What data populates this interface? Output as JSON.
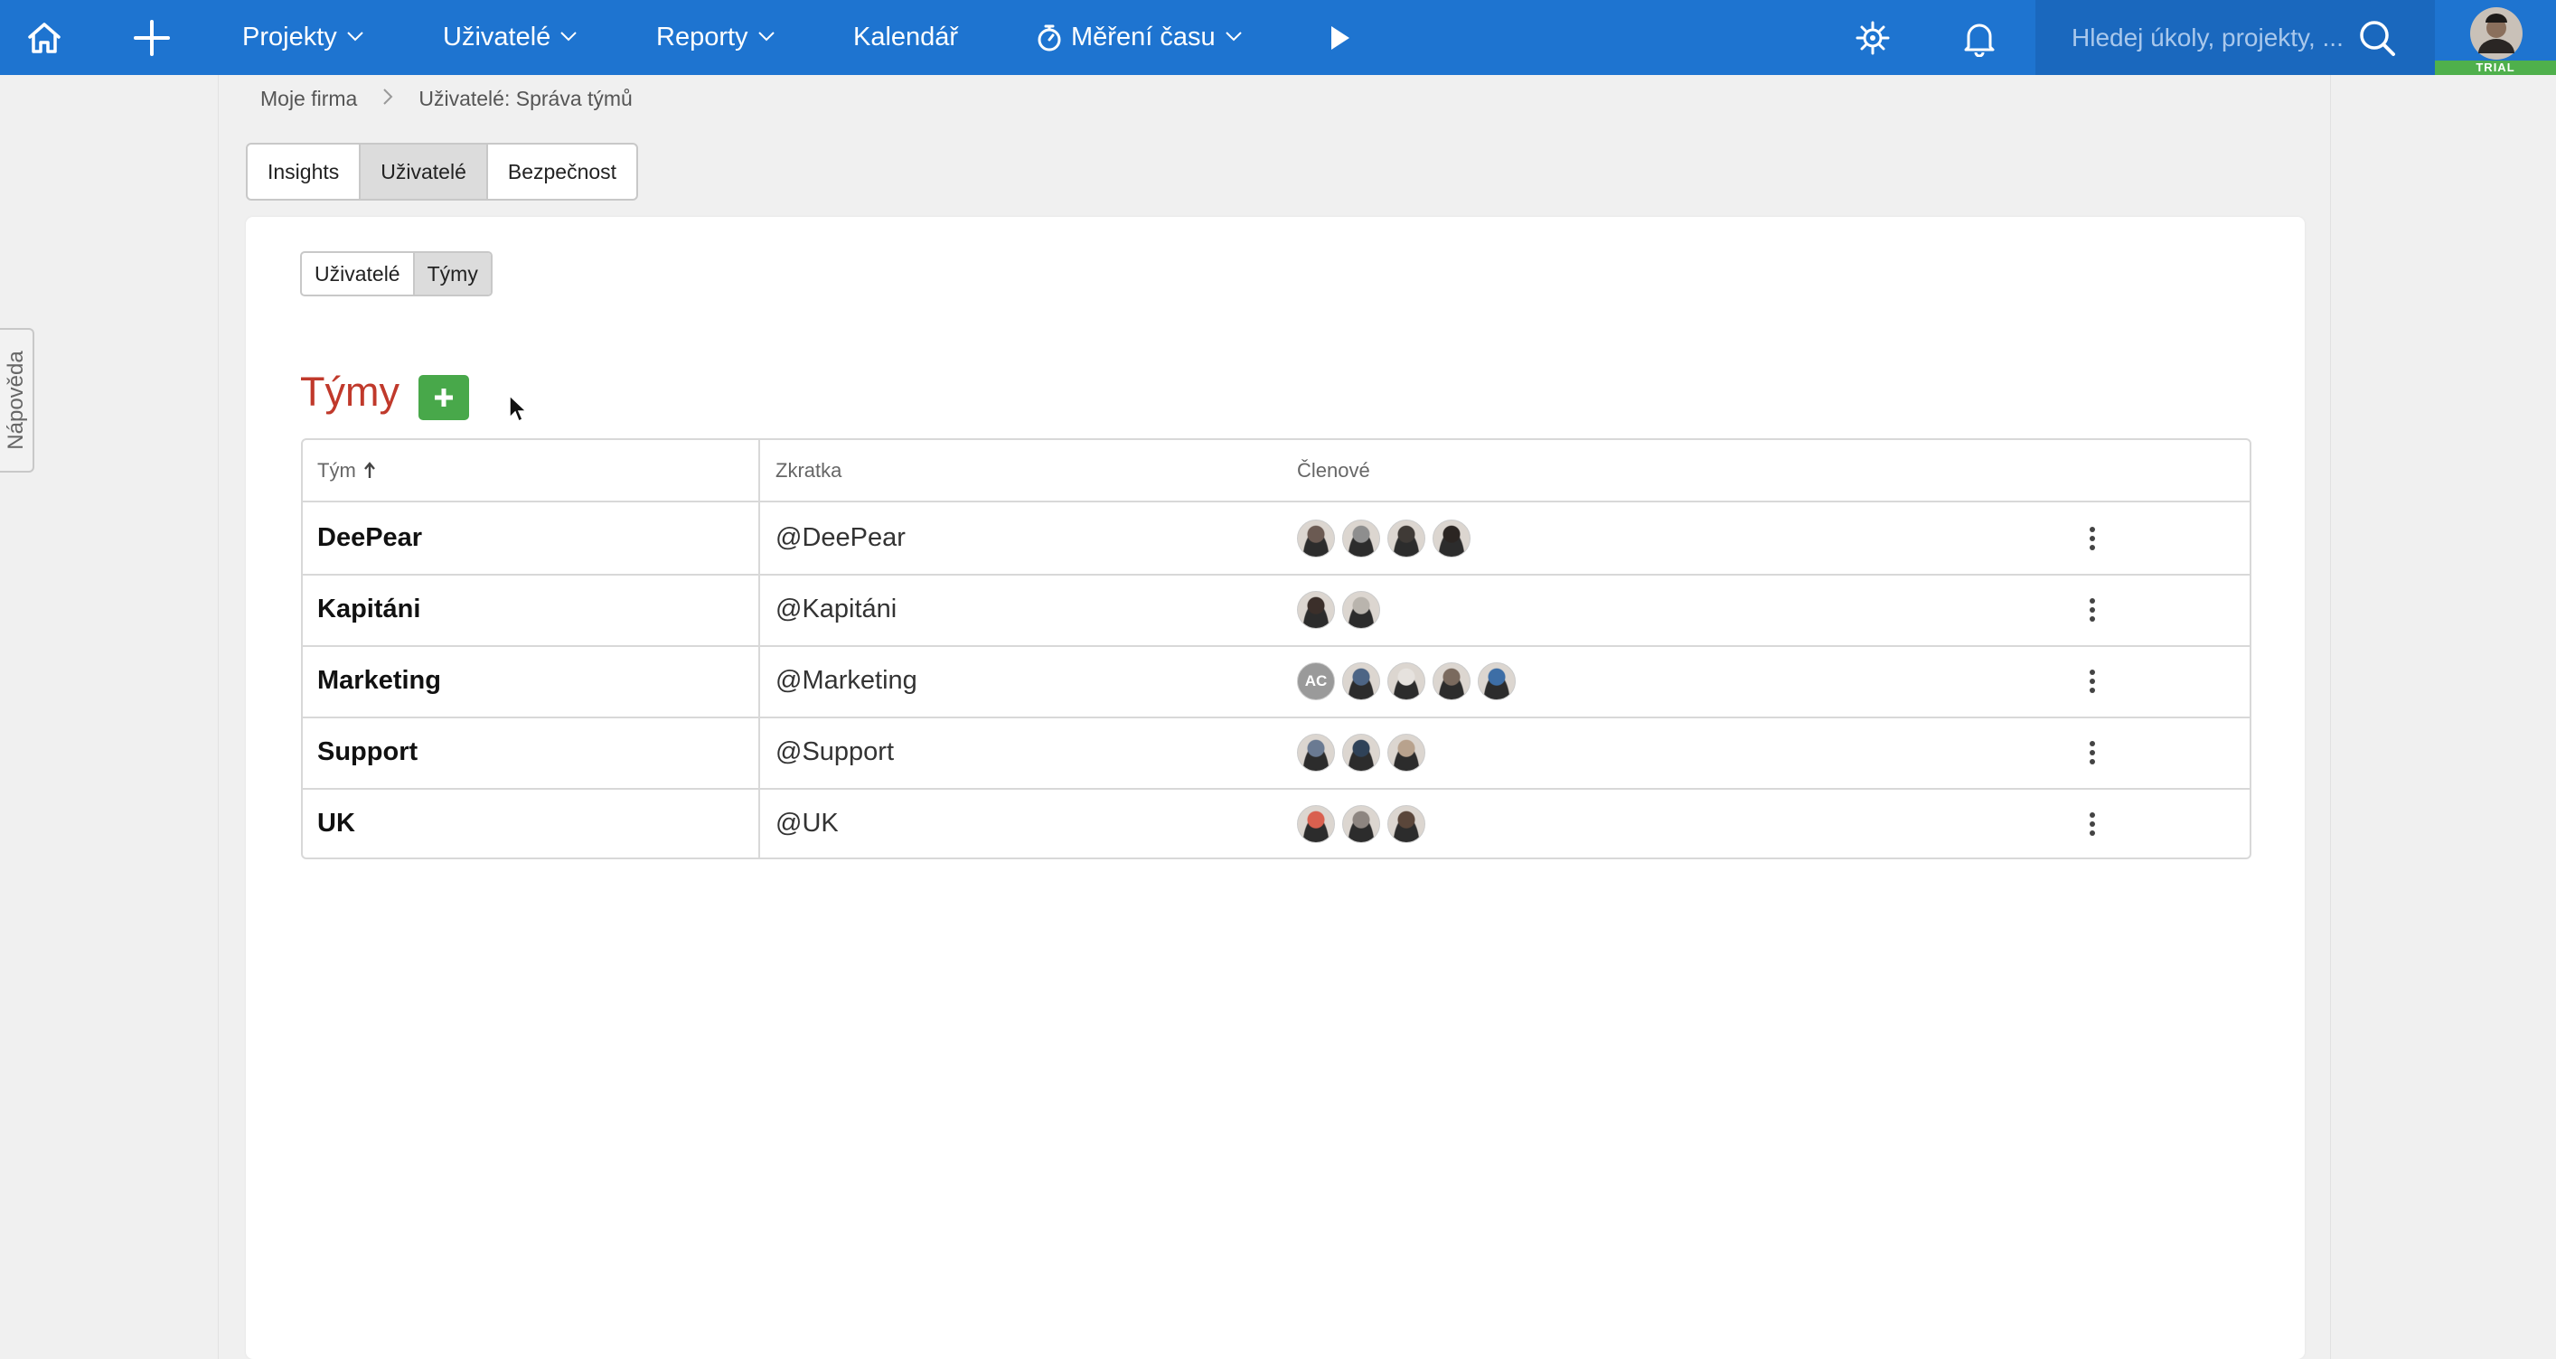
{
  "nav": {
    "projects": "Projekty",
    "users": "Uživatelé",
    "reports": "Reporty",
    "calendar": "Kalendář",
    "time_tracking": "Měření času",
    "search_placeholder": "Hledej úkoly, projekty, ...",
    "trial_badge": "TRIAL"
  },
  "help_tab": "Nápověda",
  "breadcrumb": {
    "home": "Moje firma",
    "current": "Uživatelé: Správa týmů"
  },
  "tabs": [
    "Insights",
    "Uživatelé",
    "Bezpečnost"
  ],
  "active_tab": "Uživatelé",
  "subtabs": [
    "Uživatelé",
    "Týmy"
  ],
  "active_subtab": "Týmy",
  "heading": "Týmy",
  "table": {
    "columns": {
      "team": "Tým",
      "abbr": "Zkratka",
      "members": "Členové"
    },
    "sort": "ascending",
    "rows": [
      {
        "team": "DeePear",
        "abbr": "@DeePear",
        "members": [
          "#6b5a52",
          "#8e8e8e",
          "#3f3a36",
          "#2b2522"
        ]
      },
      {
        "team": "Kapitáni",
        "abbr": "@Kapitáni",
        "members": [
          "#3b2f2a",
          "#b9b4ad"
        ]
      },
      {
        "team": "Marketing",
        "abbr": "@Marketing",
        "members": [
          "AC",
          "#4d6585",
          "#e6e2de",
          "#7a6a5e",
          "#3d6ea6"
        ]
      },
      {
        "team": "Support",
        "abbr": "@Support",
        "members": [
          "#6a7a92",
          "#2f4258",
          "#b8a28d"
        ]
      },
      {
        "team": "UK",
        "abbr": "@UK",
        "members": [
          "#d9604f",
          "#8d8580",
          "#5a463a"
        ]
      }
    ]
  },
  "colors": {
    "topbar": "#1e74d0",
    "heading": "#c0392b",
    "add_button": "#48a84a",
    "trial": "#4fb04c"
  }
}
